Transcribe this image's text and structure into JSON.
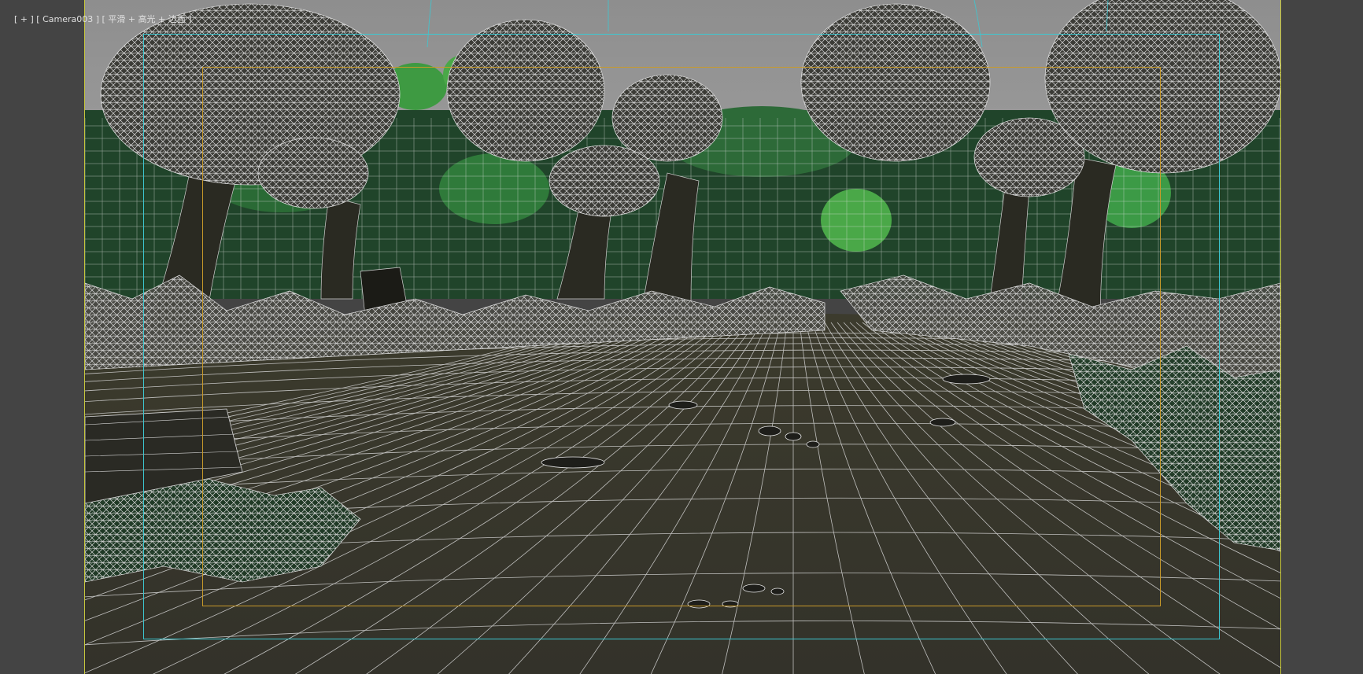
{
  "viewport": {
    "menu_plus": "[ + ]",
    "camera_name": "[ Camera003 ]",
    "shading_mode": "[ 平滑 + 高光 + 边面 ]"
  },
  "colors": {
    "frame_border": "#c8c83c",
    "safe_outer": "#3cc8d2",
    "safe_inner": "#c89a2a",
    "wire": "#cfcfcf",
    "ground": "#3a3a2c",
    "sky": "#9a9a9a",
    "foliage_dark": "#2f5f35",
    "foliage_bright": "#3c9a46"
  }
}
